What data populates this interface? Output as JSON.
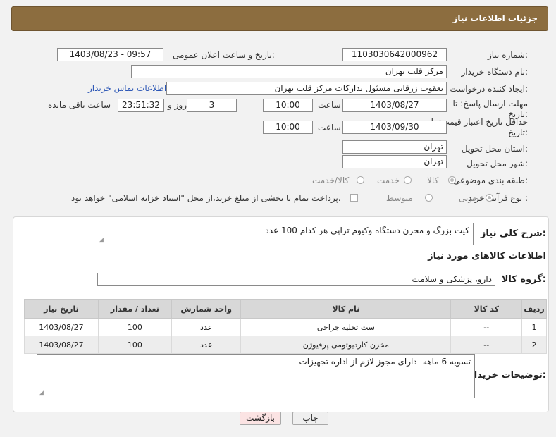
{
  "header": {
    "title": "جزئیات اطلاعات نیاز"
  },
  "form": {
    "need_number_label": "شماره نیاز:",
    "need_number": "1103030642000962",
    "announce_label": "تاریخ و ساعت اعلان عمومی:",
    "announce_value": "1403/08/23 - 09:57",
    "buyer_org_label": "نام دستگاه خریدار:",
    "buyer_org": "مرکز قلب تهران",
    "creator_label": "ایجاد کننده درخواست:",
    "creator": "یعقوب زرقانی مسئول تدارکات مرکز قلب تهران",
    "contact_link": "اطلاعات تماس خریدار",
    "deadline_label_1": "مهلت ارسال پاسخ: تا",
    "deadline_label_2": "تاریخ:",
    "deadline_date": "1403/08/27",
    "time_label": "ساعت",
    "deadline_time": "10:00",
    "days_value": "3",
    "days_label": "روز و",
    "remaining_time": "23:51:32",
    "remaining_label": "ساعت باقی مانده",
    "validity_label_1": "حداقل تاریخ اعتبار قیمت: تا",
    "validity_label_2": "تاریخ:",
    "validity_date": "1403/09/30",
    "validity_time": "10:00",
    "province_label": "استان محل تحویل:",
    "province": "تهران",
    "city_label": "شهر محل تحویل:",
    "city": "تهران",
    "category_label": "طبقه بندی موضوعی:",
    "category_options": [
      "کالا",
      "خدمت",
      "کالا/خدمت"
    ],
    "process_label": "نوع فرآیند خرید :",
    "process_options": [
      "جزیی",
      "متوسط"
    ],
    "treasury_note": "پرداخت تمام یا بخشی از مبلغ خرید،از محل \"اسناد خزانه اسلامی\" خواهد بود."
  },
  "details": {
    "summary_label": "شرح کلی نیاز:",
    "summary": "کیت بزرگ و مخزن دستگاه وکیوم تراپی هر کدام 100 عدد",
    "goods_section_title": "اطلاعات کالاهای مورد نیاز",
    "goods_group_label": "گروه کالا:",
    "goods_group": "دارو، پزشکی و سلامت",
    "table_headers": [
      "ردیف",
      "کد کالا",
      "نام کالا",
      "واحد شمارش",
      "تعداد / مقدار",
      "تاریخ نیاز"
    ],
    "rows": [
      [
        "1",
        "--",
        "ست تخلیه جراحی",
        "عدد",
        "100",
        "1403/08/27"
      ],
      [
        "2",
        "--",
        "مخزن کاردیوتومی پرفیوژن",
        "عدد",
        "100",
        "1403/08/27"
      ]
    ],
    "buyer_notes_label": "توضیحات خریدار:",
    "buyer_notes": "تسویه 6 ماهه- دارای مجوز لازم از اداره تجهیزات"
  },
  "buttons": {
    "print": "چاپ",
    "back": "بازگشت"
  },
  "colors": {
    "title_bar": "#8c6d3f",
    "back_button": "#fbe3e3",
    "print_button": "#efefef"
  }
}
